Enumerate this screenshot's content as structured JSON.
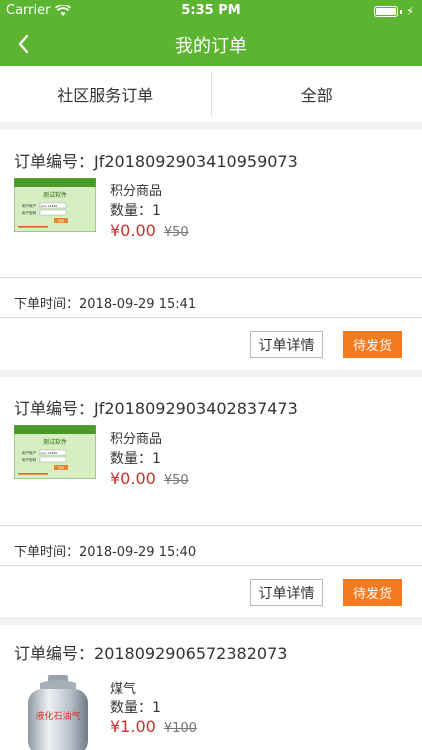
{
  "status_bar": {
    "carrier": "Carrier",
    "time": "5:35 PM"
  },
  "nav": {
    "title": "我的订单",
    "back_icon": "chevron-left-icon"
  },
  "tabs": [
    {
      "label": "社区服务订单"
    },
    {
      "label": "全部"
    }
  ],
  "labels": {
    "order_no_prefix": "订单编号：",
    "qty_prefix": "数量：",
    "time_prefix": "下单时间："
  },
  "orders": [
    {
      "order_no": "Jf2018092903410959073",
      "product_name": "积分商品",
      "quantity": "1",
      "price": "¥0.00",
      "original_price": "¥50",
      "order_time": "2018-09-29 15:41",
      "detail_label": "订单详情",
      "status_label": "待发货",
      "thumb": {
        "title": "测试软件",
        "username_label": "用户帐户",
        "username_value": "pan 12488",
        "password_label": "用户密码",
        "login": "登录"
      }
    },
    {
      "order_no": "Jf2018092903402837473",
      "product_name": "积分商品",
      "quantity": "1",
      "price": "¥0.00",
      "original_price": "¥50",
      "order_time": "2018-09-29 15:40",
      "detail_label": "订单详情",
      "status_label": "待发货",
      "thumb": {
        "title": "测试软件",
        "username_label": "用户帐户",
        "username_value": "pan 12488",
        "password_label": "用户密码",
        "login": "登录"
      }
    },
    {
      "order_no": "2018092906572382073",
      "product_name": "煤气",
      "quantity": "1",
      "price": "¥1.00",
      "original_price": "¥100",
      "thumb": {
        "label": "液化石油气"
      }
    }
  ],
  "colors": {
    "header": "#5cb531",
    "price": "#c9302c",
    "status_button": "#f57a1f"
  }
}
